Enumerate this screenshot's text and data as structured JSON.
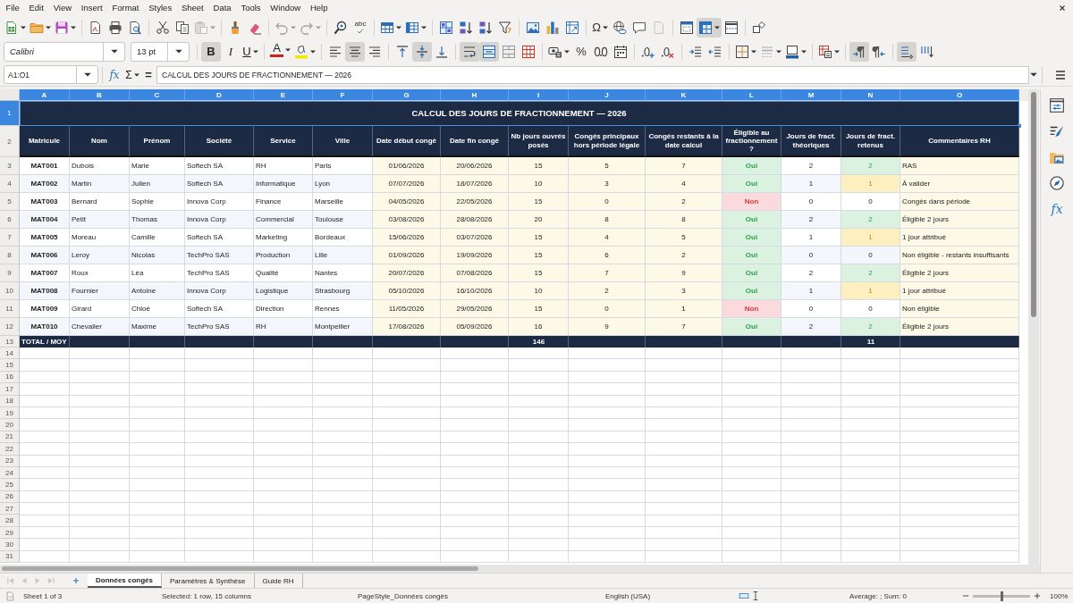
{
  "menu": [
    "File",
    "Edit",
    "View",
    "Insert",
    "Format",
    "Styles",
    "Sheet",
    "Data",
    "Tools",
    "Window",
    "Help"
  ],
  "standard_toolbar": {
    "paste_disabled": true,
    "undo_disabled": true,
    "redo_disabled": true,
    "header_footer_disabled": true,
    "spellcheck_label": "abc",
    "special_character_glyph": "Ω",
    "freeze_pressed": true
  },
  "format_toolbar": {
    "font_name": "Calibri",
    "font_size": "13 pt",
    "bold": {
      "glyph": "B",
      "pressed": true
    },
    "italic": {
      "glyph": "I",
      "pressed": false
    },
    "underline": {
      "glyph": "U",
      "pressed": false
    },
    "font_color_glyph": "A",
    "percent_glyph": "%",
    "pressed": {
      "align_left": false,
      "align_center": true,
      "align_right": false,
      "align_top": false,
      "align_middle": true,
      "align_bottom": false,
      "wrap_text": true,
      "merge_and_center": true,
      "merge_cells": false,
      "unmerge_cells": false,
      "left_to_right": true,
      "right_to_left": false,
      "text_horizontal": true,
      "text_vertical": false
    }
  },
  "formula_bar": {
    "name_box": "A1:O1",
    "function_wizard_glyph": "fx",
    "sum_glyph": "Σ",
    "equals_glyph": "=",
    "content": "CALCUL DES JOURS DE FRACTIONNEMENT — 2026"
  },
  "sheet": {
    "columns": [
      {
        "label": "A",
        "selected": true
      },
      {
        "label": "B",
        "selected": true
      },
      {
        "label": "C",
        "selected": true
      },
      {
        "label": "D",
        "selected": true
      },
      {
        "label": "E",
        "selected": true
      },
      {
        "label": "F",
        "selected": true
      },
      {
        "label": "G",
        "selected": true
      },
      {
        "label": "H",
        "selected": true
      },
      {
        "label": "I",
        "selected": true
      },
      {
        "label": "J",
        "selected": true
      },
      {
        "label": "K",
        "selected": true
      },
      {
        "label": "L",
        "selected": true
      },
      {
        "label": "M",
        "selected": true
      },
      {
        "label": "N",
        "selected": true
      },
      {
        "label": "O",
        "selected": true
      }
    ],
    "row_headers": [
      {
        "label": "1",
        "selected": true
      },
      {
        "label": "2",
        "selected": false
      },
      {
        "label": "3",
        "selected": false
      },
      {
        "label": "4",
        "selected": false
      },
      {
        "label": "5",
        "selected": false
      },
      {
        "label": "6",
        "selected": false
      },
      {
        "label": "7",
        "selected": false
      },
      {
        "label": "8",
        "selected": false
      },
      {
        "label": "9",
        "selected": false
      },
      {
        "label": "10",
        "selected": false
      },
      {
        "label": "11",
        "selected": false
      },
      {
        "label": "12",
        "selected": false
      },
      {
        "label": "13",
        "selected": false
      },
      {
        "label": "14",
        "selected": false
      },
      {
        "label": "15",
        "selected": false
      },
      {
        "label": "16",
        "selected": false
      },
      {
        "label": "17",
        "selected": false
      },
      {
        "label": "18",
        "selected": false
      },
      {
        "label": "19",
        "selected": false
      },
      {
        "label": "20",
        "selected": false
      },
      {
        "label": "21",
        "selected": false
      },
      {
        "label": "22",
        "selected": false
      },
      {
        "label": "23",
        "selected": false
      },
      {
        "label": "24",
        "selected": false
      },
      {
        "label": "25",
        "selected": false
      },
      {
        "label": "26",
        "selected": false
      },
      {
        "label": "27",
        "selected": false
      },
      {
        "label": "28",
        "selected": false
      },
      {
        "label": "29",
        "selected": false
      },
      {
        "label": "30",
        "selected": false
      },
      {
        "label": "31",
        "selected": false
      }
    ],
    "title": {
      "text": "CALCUL DES JOURS DE FRACTIONNEMENT — 2026",
      "selected": true
    },
    "headers": [
      "Matricule",
      "Nom",
      "Prénom",
      "Société",
      "Service",
      "Ville",
      "Date début congé",
      "Date fin congé",
      "Nb jours ouvrés posés",
      "Congés principaux hors période légale",
      "Congés restants à la date calcul",
      "Éligible au fractionnement ?",
      "Jours de fract. théoriques",
      "Jours de fract. retenus",
      "Commentaires RH"
    ],
    "rows": [
      {
        "id": "MAT001",
        "last_name": "Dubois",
        "first_name": "Marie",
        "company": "Softech SA",
        "department": "RH",
        "city": "Paris",
        "start_date": "01/06/2026",
        "end_date": "20/06/2026",
        "working_days": "15",
        "main_leave_outside_period": "5",
        "remaining_leave": "7",
        "eligible": {
          "text": "Oui",
          "kind": "yes"
        },
        "theoretical_days": "2",
        "retained": {
          "text": "2",
          "kind": "full"
        },
        "comment": "RAS"
      },
      {
        "id": "MAT002",
        "last_name": "Martin",
        "first_name": "Julien",
        "company": "Softech SA",
        "department": "Informatique",
        "city": "Lyon",
        "start_date": "07/07/2026",
        "end_date": "18/07/2026",
        "working_days": "10",
        "main_leave_outside_period": "3",
        "remaining_leave": "4",
        "eligible": {
          "text": "Oui",
          "kind": "yes"
        },
        "theoretical_days": "1",
        "retained": {
          "text": "1",
          "kind": "partial"
        },
        "comment": "À valider"
      },
      {
        "id": "MAT003",
        "last_name": "Bernard",
        "first_name": "Sophie",
        "company": "Innova Corp",
        "department": "Finance",
        "city": "Marseille",
        "start_date": "04/05/2026",
        "end_date": "22/05/2026",
        "working_days": "15",
        "main_leave_outside_period": "0",
        "remaining_leave": "2",
        "eligible": {
          "text": "Non",
          "kind": "no"
        },
        "theoretical_days": "0",
        "retained": {
          "text": "0",
          "kind": "plain"
        },
        "comment": "Congés dans période"
      },
      {
        "id": "MAT004",
        "last_name": "Petit",
        "first_name": "Thomas",
        "company": "Innova Corp",
        "department": "Commercial",
        "city": "Toulouse",
        "start_date": "03/08/2026",
        "end_date": "28/08/2026",
        "working_days": "20",
        "main_leave_outside_period": "8",
        "remaining_leave": "8",
        "eligible": {
          "text": "Oui",
          "kind": "yes"
        },
        "theoretical_days": "2",
        "retained": {
          "text": "2",
          "kind": "full"
        },
        "comment": "Éligible 2 jours"
      },
      {
        "id": "MAT005",
        "last_name": "Moreau",
        "first_name": "Camille",
        "company": "Softech SA",
        "department": "Marketing",
        "city": "Bordeaux",
        "start_date": "15/06/2026",
        "end_date": "03/07/2026",
        "working_days": "15",
        "main_leave_outside_period": "4",
        "remaining_leave": "5",
        "eligible": {
          "text": "Oui",
          "kind": "yes"
        },
        "theoretical_days": "1",
        "retained": {
          "text": "1",
          "kind": "partial"
        },
        "comment": "1 jour attribué"
      },
      {
        "id": "MAT006",
        "last_name": "Leroy",
        "first_name": "Nicolas",
        "company": "TechPro SAS",
        "department": "Production",
        "city": "Lille",
        "start_date": "01/09/2026",
        "end_date": "19/09/2026",
        "working_days": "15",
        "main_leave_outside_period": "6",
        "remaining_leave": "2",
        "eligible": {
          "text": "Oui",
          "kind": "yes"
        },
        "theoretical_days": "0",
        "retained": {
          "text": "0",
          "kind": "plain"
        },
        "comment": "Non éligible - restants insuffisants"
      },
      {
        "id": "MAT007",
        "last_name": "Roux",
        "first_name": "Léa",
        "company": "TechPro SAS",
        "department": "Qualité",
        "city": "Nantes",
        "start_date": "20/07/2026",
        "end_date": "07/08/2026",
        "working_days": "15",
        "main_leave_outside_period": "7",
        "remaining_leave": "9",
        "eligible": {
          "text": "Oui",
          "kind": "yes"
        },
        "theoretical_days": "2",
        "retained": {
          "text": "2",
          "kind": "full"
        },
        "comment": "Éligible 2 jours"
      },
      {
        "id": "MAT008",
        "last_name": "Fournier",
        "first_name": "Antoine",
        "company": "Innova Corp",
        "department": "Logistique",
        "city": "Strasbourg",
        "start_date": "05/10/2026",
        "end_date": "16/10/2026",
        "working_days": "10",
        "main_leave_outside_period": "2",
        "remaining_leave": "3",
        "eligible": {
          "text": "Oui",
          "kind": "yes"
        },
        "theoretical_days": "1",
        "retained": {
          "text": "1",
          "kind": "partial"
        },
        "comment": "1 jour attribué"
      },
      {
        "id": "MAT009",
        "last_name": "Girard",
        "first_name": "Chloé",
        "company": "Softech SA",
        "department": "Direction",
        "city": "Rennes",
        "start_date": "11/05/2026",
        "end_date": "29/05/2026",
        "working_days": "15",
        "main_leave_outside_period": "0",
        "remaining_leave": "1",
        "eligible": {
          "text": "Non",
          "kind": "no"
        },
        "theoretical_days": "0",
        "retained": {
          "text": "0",
          "kind": "plain"
        },
        "comment": "Non éligible"
      },
      {
        "id": "MAT010",
        "last_name": "Chevalier",
        "first_name": "Maxime",
        "company": "TechPro SAS",
        "department": "RH",
        "city": "Montpellier",
        "start_date": "17/08/2026",
        "end_date": "05/09/2026",
        "working_days": "16",
        "main_leave_outside_period": "9",
        "remaining_leave": "7",
        "eligible": {
          "text": "Oui",
          "kind": "yes"
        },
        "theoretical_days": "2",
        "retained": {
          "text": "2",
          "kind": "full"
        },
        "comment": "Éligible 2 jours"
      }
    ],
    "total_row": {
      "label": "TOTAL / MOY",
      "working_days": "146",
      "retained_days": "11"
    }
  },
  "sidebar": {
    "functions_glyph": "fx"
  },
  "sheet_tabs": [
    {
      "label": "Données congés",
      "selected": true
    },
    {
      "label": "Paramètres & Synthèse",
      "selected": false
    },
    {
      "label": "Guide RH",
      "selected": false
    }
  ],
  "status_bar": {
    "sheet_position": "Sheet 1 of 3",
    "selection": "Selected: 1 row, 15 columns",
    "page_style": "PageStyle_Données congés",
    "language": "English (USA)",
    "summary": "Average: ; Sum: 0",
    "zoom_slider": {
      "level": 0.5
    },
    "zoom": "100%"
  }
}
